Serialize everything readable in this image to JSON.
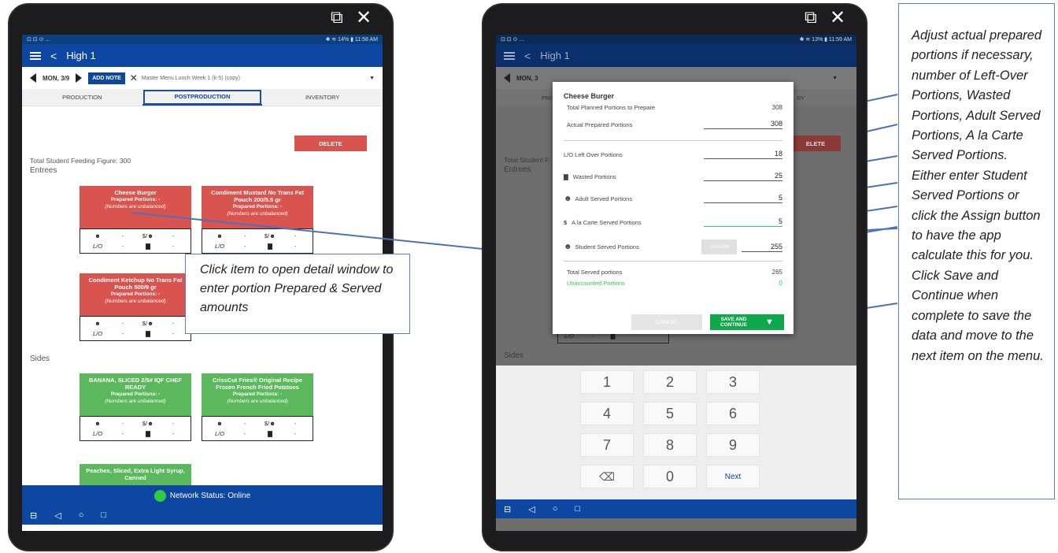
{
  "left_tablet": {
    "window_controls": [
      "⧉",
      "✕"
    ],
    "status_bar": {
      "left": "⊡ ⊡ ⊙ ...",
      "right": "✱ ≋ 14% ▮ 11:58 AM"
    },
    "app_title": "High 1",
    "date": "MON, 3/9",
    "add_note": "ADD NOTE",
    "menu_name": "Master Menu Lunch Week 1 (k-5) (copy)",
    "tabs": [
      "PRODUCTION",
      "POSTPRODUCTION",
      "INVENTORY"
    ],
    "delete_label": "DELETE",
    "feeding_figure": "Total Student Feeding Figure: 300",
    "entrees_title": "Entrees",
    "sides_title": "Sides",
    "prepared_text": "Prepared Portions: -",
    "unbalanced_text": "(Numbers are unbalanced)",
    "grid": {
      "dash": "-",
      "ala_carte_symbol": "$/☻",
      "lo": "L/O"
    },
    "entrees": [
      {
        "name": "Cheese Burger"
      },
      {
        "name": "Condiment Mustard No Trans Fat Pouch 200/5.5 gr"
      },
      {
        "name": "Condiment Ketchup No Trans Fat Pouch 500/9 gr"
      }
    ],
    "sides": [
      {
        "name": "BANANA, SLICED 2/5# IQF CHEF READY"
      },
      {
        "name": "CrissCut Fries® Original Recipe Frozen French Fried Potatoes"
      },
      {
        "name": "Peaches, Sliced, Extra Light Syrup, Canned"
      }
    ],
    "network_status": "Network Status: Online",
    "nav": [
      "⊟",
      "◁",
      "○",
      "□"
    ]
  },
  "callout_left": "Click item to open detail window to enter portion Prepared & Served amounts",
  "right_tablet": {
    "window_controls": [
      "⧉",
      "✕"
    ],
    "status_bar": {
      "left": "⊡ ⊡ ⊙ ...",
      "right": "✱ ≋ 13% ▮ 11:59 AM"
    },
    "app_title": "High 1",
    "behind": {
      "date": "MON, 3",
      "tab_left": "PRO",
      "tab_right": "RY",
      "delete": "ELETE",
      "feeding": "Total Student F",
      "entrees": "Entrees",
      "sides": "Sides",
      "lo_row": "L/O"
    },
    "dialog": {
      "title": "Cheese Burger",
      "planned_label": "Total Planned Portions to Prepare",
      "planned_value": "308",
      "actual_label": "Actual Prepared Portions",
      "actual_value": "308",
      "leftover_label": "L/O Left Over Portions",
      "leftover_value": "18",
      "wasted_label": "Wasted Portions",
      "wasted_value": "25",
      "adult_label": "Adult Served Portions",
      "adult_value": "5",
      "alacarte_label": "A la Carte Served Portions",
      "alacarte_value": "5",
      "student_label": "Student Served Portions",
      "assign_label": "ASSIGN",
      "student_value": "255",
      "total_label": "Total Served portions",
      "total_value": "265",
      "unaccounted_label": "Unaccounted Portions",
      "unaccounted_value": "0",
      "cancel_label": "CANCEL",
      "save_label": "SAVE AND CONTINUE"
    },
    "keypad": [
      "1",
      "2",
      "3",
      "4",
      "5",
      "6",
      "7",
      "8",
      "9",
      "⌫",
      "0",
      "Next"
    ],
    "nav": [
      "⊟",
      "◁",
      "○",
      "□"
    ]
  },
  "callout_right": "Adjust actual prepared portions if necessary, number of Left-Over Portions, Wasted Portions, Adult Served Portions, A la Carte Served Portions. Either enter Student Served Portions or click the Assign button to have the app calculate this for you. Click Save and Continue when complete to save the data and move to the next item on the menu.",
  "colors": {
    "brand": "#0d47a1",
    "entree": "#d9534f",
    "side": "#5cb85c",
    "accent_green": "#2ecc40"
  }
}
